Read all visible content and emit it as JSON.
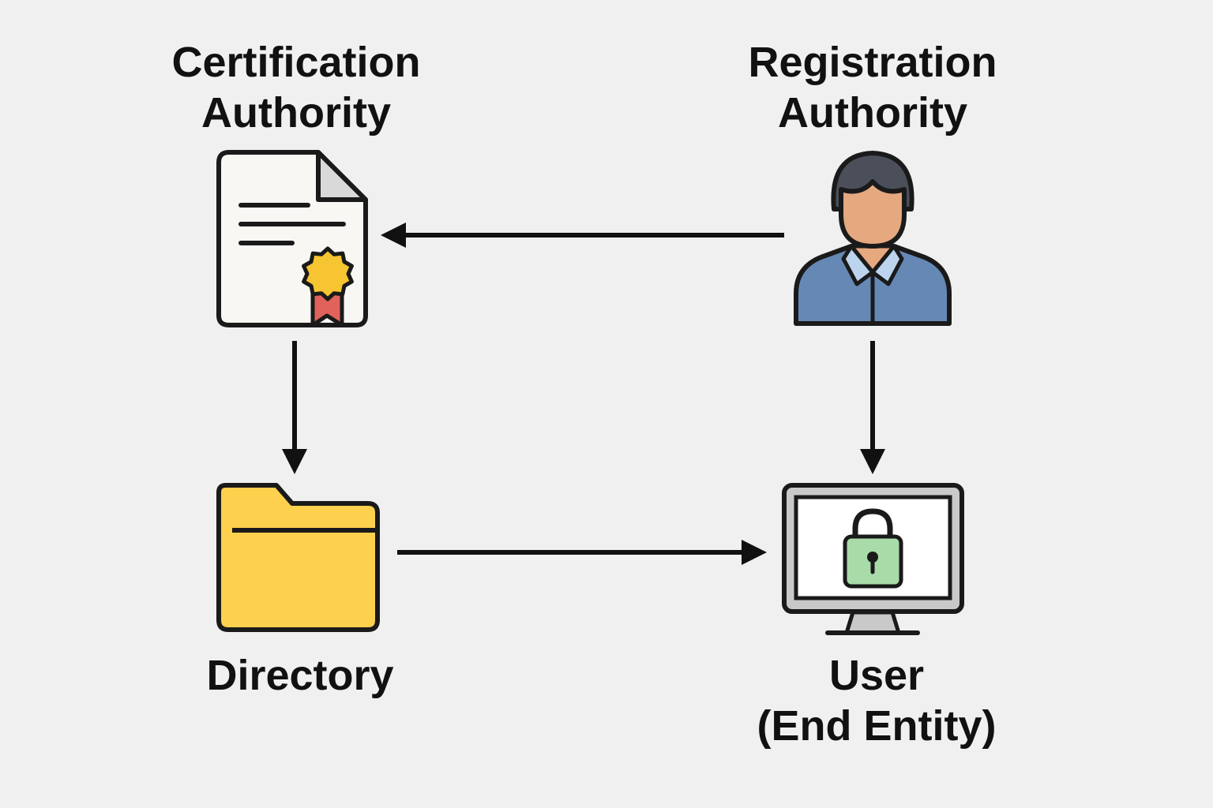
{
  "nodes": {
    "certification_authority": {
      "line1": "Certification",
      "line2": "Authority",
      "icon": "certificate-icon"
    },
    "registration_authority": {
      "line1": "Registration",
      "line2": "Authority",
      "icon": "person-icon"
    },
    "directory": {
      "line1": "Directory",
      "icon": "folder-icon"
    },
    "user": {
      "line1": "User",
      "line2": "(End Entity)",
      "icon": "monitor-lock-icon"
    }
  },
  "edges": [
    {
      "from": "registration_authority",
      "to": "certification_authority"
    },
    {
      "from": "certification_authority",
      "to": "directory"
    },
    {
      "from": "registration_authority",
      "to": "user"
    },
    {
      "from": "directory",
      "to": "user"
    }
  ],
  "colors": {
    "background": "#f0f0f0",
    "outline": "#1a1a1a",
    "paper": "#f8f7f4",
    "paper_fold": "#d9d9d9",
    "seal": "#f7c531",
    "ribbon": "#e0625a",
    "hair": "#4a4f5a",
    "skin": "#e5a87f",
    "shirt": "#6688b5",
    "collar": "#bcd4ee",
    "folder": "#fdd04d",
    "monitor_frame": "#c9c9c9",
    "screen": "#ffffff",
    "lock_body": "#a8dba8",
    "stand": "#c9c9c9"
  }
}
